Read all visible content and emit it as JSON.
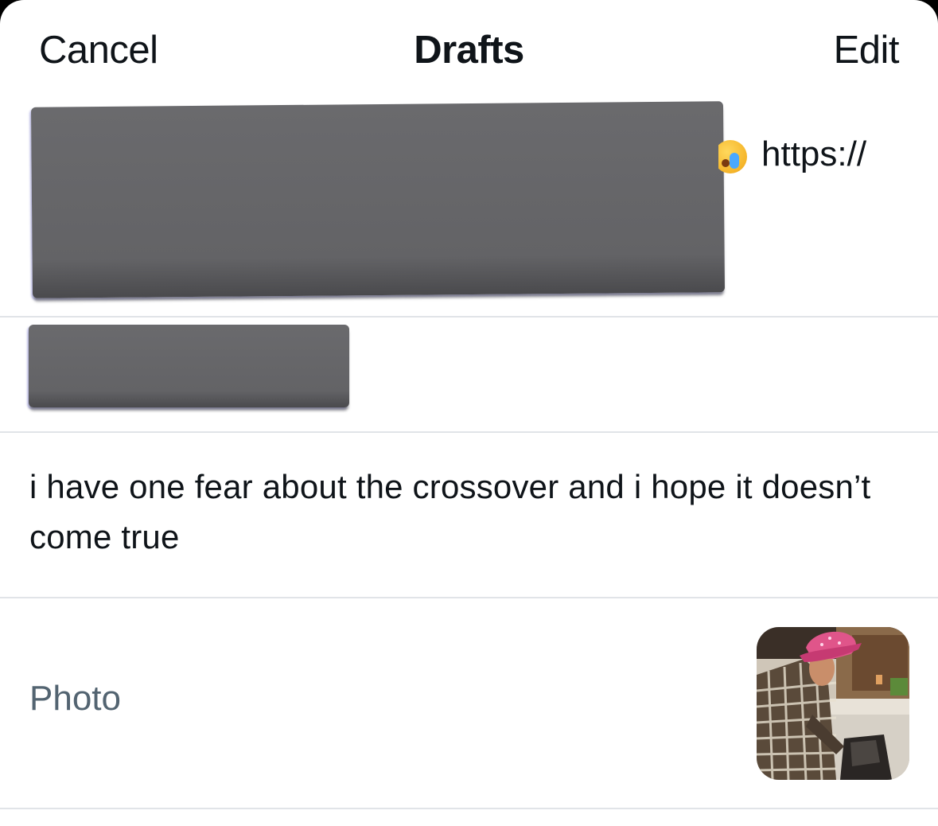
{
  "header": {
    "cancel_label": "Cancel",
    "title": "Drafts",
    "edit_label": "Edit"
  },
  "drafts": [
    {
      "visible_text": "https://",
      "emoji": "loudly-crying-face-icon",
      "redacted": true
    },
    {
      "redacted": true
    },
    {
      "text": "i have one fear about the crossover and i hope it doesn’t come true"
    },
    {
      "label": "Photo",
      "thumbnail": "photo-thumbnail"
    }
  ],
  "colors": {
    "text_primary": "#0f1419",
    "text_secondary": "#536471",
    "divider": "#e1e4e8",
    "redaction": "#636366",
    "background": "#ffffff"
  }
}
